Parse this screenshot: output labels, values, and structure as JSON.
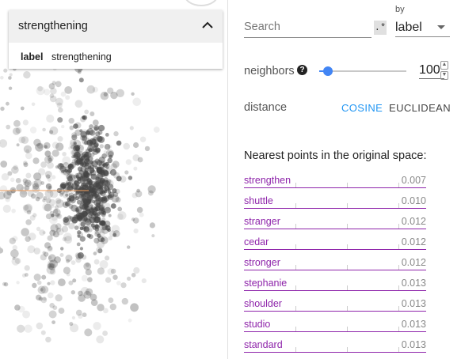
{
  "selection": {
    "title": "strengthening",
    "row_key": "label",
    "row_value": "strengthening"
  },
  "search": {
    "placeholder": "Search",
    "regex_label": ".*",
    "by_label": "by",
    "by_value": "label"
  },
  "neighbors": {
    "label": "neighbors",
    "help": "?",
    "value": "100",
    "slider_fraction": 0.1
  },
  "distance": {
    "label": "distance",
    "options": [
      "COSINE",
      "EUCLIDEAN"
    ],
    "selected": "COSINE"
  },
  "nearest": {
    "title": "Nearest points in the original space:",
    "items": [
      {
        "word": "strengthen",
        "value": "0.007"
      },
      {
        "word": "shuttle",
        "value": "0.010"
      },
      {
        "word": "stranger",
        "value": "0.012"
      },
      {
        "word": "cedar",
        "value": "0.012"
      },
      {
        "word": "stronger",
        "value": "0.012"
      },
      {
        "word": "stephanie",
        "value": "0.013"
      },
      {
        "word": "shoulder",
        "value": "0.013"
      },
      {
        "word": "studio",
        "value": "0.013"
      },
      {
        "word": "standard",
        "value": "0.013"
      }
    ]
  },
  "colors": {
    "accent": "#2196f3",
    "neighbor": "#8e24aa",
    "slider": "#4285f4"
  }
}
